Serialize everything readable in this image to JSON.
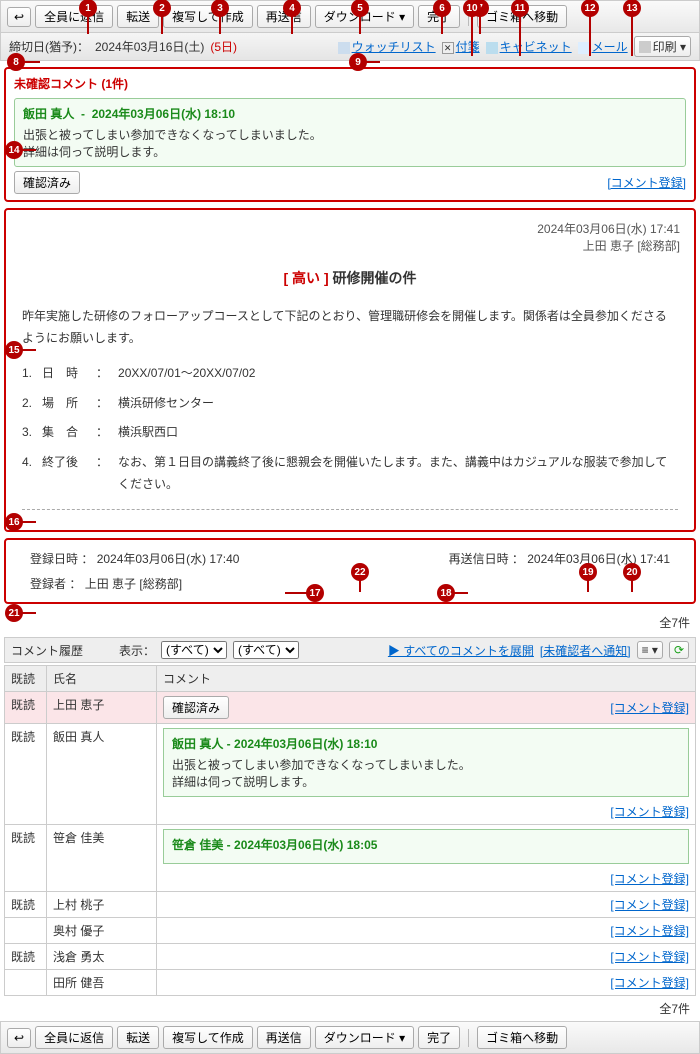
{
  "toolbar": {
    "back_icon": "↩",
    "reply_all": "全員に返信",
    "forward": "転送",
    "duplicate": "複写して作成",
    "resend": "再送信",
    "download": "ダウンロード ▾",
    "complete": "完了",
    "to_trash": "ゴミ箱へ移動"
  },
  "subbar": {
    "deadline_label": "締切日(猶予)：",
    "deadline_value": "2024年03月16日(土)",
    "grace": "(5日)",
    "watchlist": "ウォッチリスト",
    "fusen": "付箋",
    "cabinet": "キャビネット",
    "mail": "メール",
    "print": "印刷 ▾",
    "x_icon": "✕"
  },
  "unconfirmed": {
    "title": "未確認コメント (1件)",
    "author": "飯田 真人",
    "datetime": "2024年03月06日(水) 18:10",
    "line1": "出張と被ってしまい参加できなくなってしまいました。",
    "line2": "詳細は伺って説明します。",
    "confirmed_btn": "確認済み",
    "register_link": "[コメント登録]"
  },
  "message": {
    "sent_at": "2024年03月06日(水) 17:41",
    "sender": "上田 恵子 [総務部]",
    "tag": "[ 高い ]",
    "title": "研修開催の件",
    "lead": "昨年実施した研修のフォローアップコースとして下記のとおり、管理職研修会を開催します。関係者は全員参加くださるようにお願いします。",
    "items": [
      {
        "label": "日　時",
        "sep": "：",
        "value": "20XX/07/01～20XX/07/02"
      },
      {
        "label": "場　所",
        "sep": "：",
        "value": "横浜研修センター"
      },
      {
        "label": "集　合",
        "sep": "：",
        "value": "横浜駅西口"
      },
      {
        "label": "終了後",
        "sep": "：",
        "value": "なお、第１日目の講義終了後に懇親会を開催いたします。また、講義中はカジュアルな服装で参加してください。"
      }
    ]
  },
  "reginfo": {
    "reg_label": "登録日時 ：",
    "reg_value": "2024年03月06日(水) 17:40",
    "resend_label": "再送信日時 ：",
    "resend_value": "2024年03月06日(水) 17:41",
    "registrar_label": "登録者 ：",
    "registrar_value": "上田 恵子 [総務部]"
  },
  "history": {
    "total": "全7件",
    "title": "コメント履歴",
    "show_label": "表示：",
    "filter_all": "(すべて)",
    "expand_all": "▶ すべてのコメントを展開",
    "notify_unconfirmed": "[未確認者へ通知]",
    "menu_icon": "≡ ▾",
    "reload_icon": "⟳",
    "head_status": "既読",
    "head_name": "氏名",
    "head_comment": "コメント",
    "rows": [
      {
        "status": "既読",
        "name": "上田 恵子",
        "confirmed": "確認済み",
        "body": null,
        "link": "[コメント登録]"
      },
      {
        "status": "既読",
        "name": "飯田 真人",
        "confirmed": null,
        "body": {
          "author": "飯田 真人",
          "dt": "2024年03月06日(水) 18:10",
          "l1": "出張と被ってしまい参加できなくなってしまいました。",
          "l2": "詳細は伺って説明します。"
        },
        "link": "[コメント登録]"
      },
      {
        "status": "既読",
        "name": "笹倉 佳美",
        "confirmed": null,
        "body": {
          "author": "笹倉 佳美",
          "dt": "2024年03月06日(水) 18:05",
          "l1": "",
          "l2": ""
        },
        "link": "[コメント登録]"
      },
      {
        "status": "既読",
        "name": "上村 桃子",
        "confirmed": null,
        "body": null,
        "link": "[コメント登録]"
      },
      {
        "status": "",
        "name": "奥村 優子",
        "confirmed": null,
        "body": null,
        "link": "[コメント登録]"
      },
      {
        "status": "既読",
        "name": "浅倉 勇太",
        "confirmed": null,
        "body": null,
        "link": "[コメント登録]"
      },
      {
        "status": "",
        "name": "田所 健吾",
        "confirmed": null,
        "body": null,
        "link": "[コメント登録]"
      }
    ]
  },
  "callouts": [
    "1",
    "2",
    "3",
    "4",
    "5",
    "6",
    "7",
    "8",
    "9",
    "10",
    "11",
    "12",
    "13",
    "14",
    "15",
    "16",
    "17",
    "18",
    "19",
    "20",
    "21",
    "22"
  ]
}
